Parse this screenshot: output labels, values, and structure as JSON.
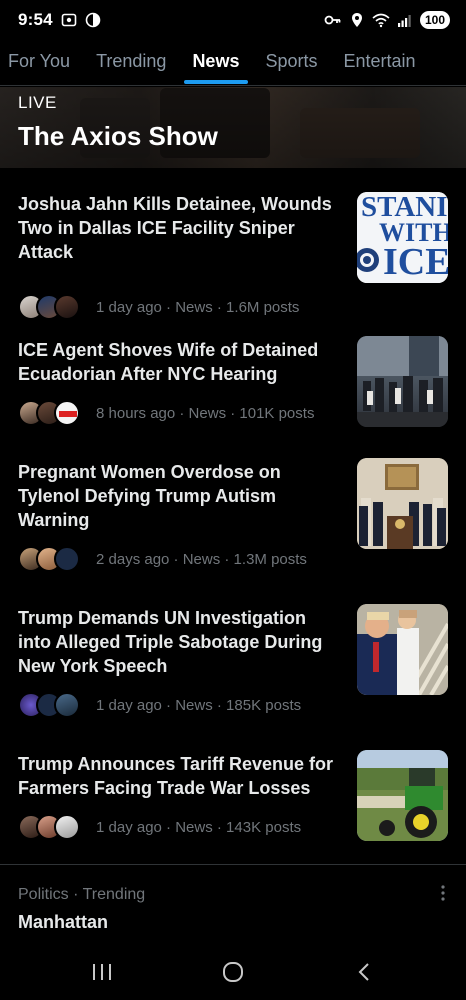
{
  "status_bar": {
    "time": "9:54",
    "battery": "100",
    "icons": [
      "screenshot-icon",
      "dnd-icon",
      "key-icon",
      "location-icon",
      "wifi-icon",
      "signal-icon"
    ]
  },
  "tabs": [
    {
      "label": "For You",
      "active": false
    },
    {
      "label": "Trending",
      "active": false
    },
    {
      "label": "News",
      "active": true
    },
    {
      "label": "Sports",
      "active": false
    },
    {
      "label": "Entertain",
      "active": false
    }
  ],
  "live": {
    "label": "LIVE",
    "title": "The Axios Show"
  },
  "news_items": [
    {
      "title": "Joshua Jahn Kills Detainee, Wounds Two in Dallas ICE Facility Sniper Attack",
      "meta": "1 day ago · News · 1.6M posts",
      "thumb_text": [
        "STANI",
        "WITH",
        "ICE"
      ]
    },
    {
      "title": "ICE Agent Shoves Wife of Detained Ecuadorian After NYC Hearing",
      "meta": "8 hours ago · News · 101K posts"
    },
    {
      "title": "Pregnant Women Overdose on Tylenol Defying Trump Autism Warning",
      "meta": "2 days ago · News · 1.3M posts"
    },
    {
      "title": "Trump Demands UN Investigation into Alleged Triple Sabotage During New York Speech",
      "meta": "1 day ago · News · 185K posts"
    },
    {
      "title": "Trump Announces Tariff Revenue for Farmers Facing Trade War Losses",
      "meta": "1 day ago · News · 143K posts"
    }
  ],
  "trending": {
    "category": "Politics · Trending",
    "name": "Manhattan"
  },
  "colors": {
    "accent": "#1d9bf0",
    "background": "#000000",
    "muted_text": "#71767b",
    "divider": "#2f3336"
  }
}
